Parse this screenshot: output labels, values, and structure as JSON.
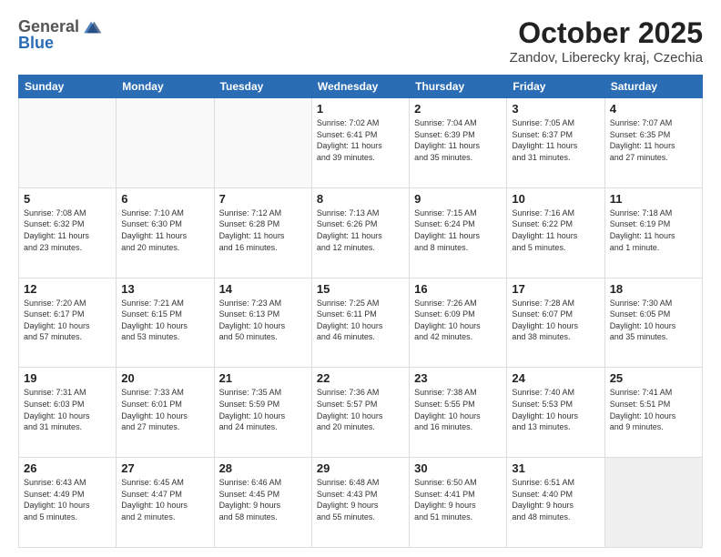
{
  "header": {
    "logo_general": "General",
    "logo_blue": "Blue",
    "month_title": "October 2025",
    "location": "Zandov, Liberecky kraj, Czechia"
  },
  "days_of_week": [
    "Sunday",
    "Monday",
    "Tuesday",
    "Wednesday",
    "Thursday",
    "Friday",
    "Saturday"
  ],
  "weeks": [
    [
      {
        "day": "",
        "text": ""
      },
      {
        "day": "",
        "text": ""
      },
      {
        "day": "",
        "text": ""
      },
      {
        "day": "1",
        "text": "Sunrise: 7:02 AM\nSunset: 6:41 PM\nDaylight: 11 hours\nand 39 minutes."
      },
      {
        "day": "2",
        "text": "Sunrise: 7:04 AM\nSunset: 6:39 PM\nDaylight: 11 hours\nand 35 minutes."
      },
      {
        "day": "3",
        "text": "Sunrise: 7:05 AM\nSunset: 6:37 PM\nDaylight: 11 hours\nand 31 minutes."
      },
      {
        "day": "4",
        "text": "Sunrise: 7:07 AM\nSunset: 6:35 PM\nDaylight: 11 hours\nand 27 minutes."
      }
    ],
    [
      {
        "day": "5",
        "text": "Sunrise: 7:08 AM\nSunset: 6:32 PM\nDaylight: 11 hours\nand 23 minutes."
      },
      {
        "day": "6",
        "text": "Sunrise: 7:10 AM\nSunset: 6:30 PM\nDaylight: 11 hours\nand 20 minutes."
      },
      {
        "day": "7",
        "text": "Sunrise: 7:12 AM\nSunset: 6:28 PM\nDaylight: 11 hours\nand 16 minutes."
      },
      {
        "day": "8",
        "text": "Sunrise: 7:13 AM\nSunset: 6:26 PM\nDaylight: 11 hours\nand 12 minutes."
      },
      {
        "day": "9",
        "text": "Sunrise: 7:15 AM\nSunset: 6:24 PM\nDaylight: 11 hours\nand 8 minutes."
      },
      {
        "day": "10",
        "text": "Sunrise: 7:16 AM\nSunset: 6:22 PM\nDaylight: 11 hours\nand 5 minutes."
      },
      {
        "day": "11",
        "text": "Sunrise: 7:18 AM\nSunset: 6:19 PM\nDaylight: 11 hours\nand 1 minute."
      }
    ],
    [
      {
        "day": "12",
        "text": "Sunrise: 7:20 AM\nSunset: 6:17 PM\nDaylight: 10 hours\nand 57 minutes."
      },
      {
        "day": "13",
        "text": "Sunrise: 7:21 AM\nSunset: 6:15 PM\nDaylight: 10 hours\nand 53 minutes."
      },
      {
        "day": "14",
        "text": "Sunrise: 7:23 AM\nSunset: 6:13 PM\nDaylight: 10 hours\nand 50 minutes."
      },
      {
        "day": "15",
        "text": "Sunrise: 7:25 AM\nSunset: 6:11 PM\nDaylight: 10 hours\nand 46 minutes."
      },
      {
        "day": "16",
        "text": "Sunrise: 7:26 AM\nSunset: 6:09 PM\nDaylight: 10 hours\nand 42 minutes."
      },
      {
        "day": "17",
        "text": "Sunrise: 7:28 AM\nSunset: 6:07 PM\nDaylight: 10 hours\nand 38 minutes."
      },
      {
        "day": "18",
        "text": "Sunrise: 7:30 AM\nSunset: 6:05 PM\nDaylight: 10 hours\nand 35 minutes."
      }
    ],
    [
      {
        "day": "19",
        "text": "Sunrise: 7:31 AM\nSunset: 6:03 PM\nDaylight: 10 hours\nand 31 minutes."
      },
      {
        "day": "20",
        "text": "Sunrise: 7:33 AM\nSunset: 6:01 PM\nDaylight: 10 hours\nand 27 minutes."
      },
      {
        "day": "21",
        "text": "Sunrise: 7:35 AM\nSunset: 5:59 PM\nDaylight: 10 hours\nand 24 minutes."
      },
      {
        "day": "22",
        "text": "Sunrise: 7:36 AM\nSunset: 5:57 PM\nDaylight: 10 hours\nand 20 minutes."
      },
      {
        "day": "23",
        "text": "Sunrise: 7:38 AM\nSunset: 5:55 PM\nDaylight: 10 hours\nand 16 minutes."
      },
      {
        "day": "24",
        "text": "Sunrise: 7:40 AM\nSunset: 5:53 PM\nDaylight: 10 hours\nand 13 minutes."
      },
      {
        "day": "25",
        "text": "Sunrise: 7:41 AM\nSunset: 5:51 PM\nDaylight: 10 hours\nand 9 minutes."
      }
    ],
    [
      {
        "day": "26",
        "text": "Sunrise: 6:43 AM\nSunset: 4:49 PM\nDaylight: 10 hours\nand 5 minutes."
      },
      {
        "day": "27",
        "text": "Sunrise: 6:45 AM\nSunset: 4:47 PM\nDaylight: 10 hours\nand 2 minutes."
      },
      {
        "day": "28",
        "text": "Sunrise: 6:46 AM\nSunset: 4:45 PM\nDaylight: 9 hours\nand 58 minutes."
      },
      {
        "day": "29",
        "text": "Sunrise: 6:48 AM\nSunset: 4:43 PM\nDaylight: 9 hours\nand 55 minutes."
      },
      {
        "day": "30",
        "text": "Sunrise: 6:50 AM\nSunset: 4:41 PM\nDaylight: 9 hours\nand 51 minutes."
      },
      {
        "day": "31",
        "text": "Sunrise: 6:51 AM\nSunset: 4:40 PM\nDaylight: 9 hours\nand 48 minutes."
      },
      {
        "day": "",
        "text": ""
      }
    ]
  ]
}
